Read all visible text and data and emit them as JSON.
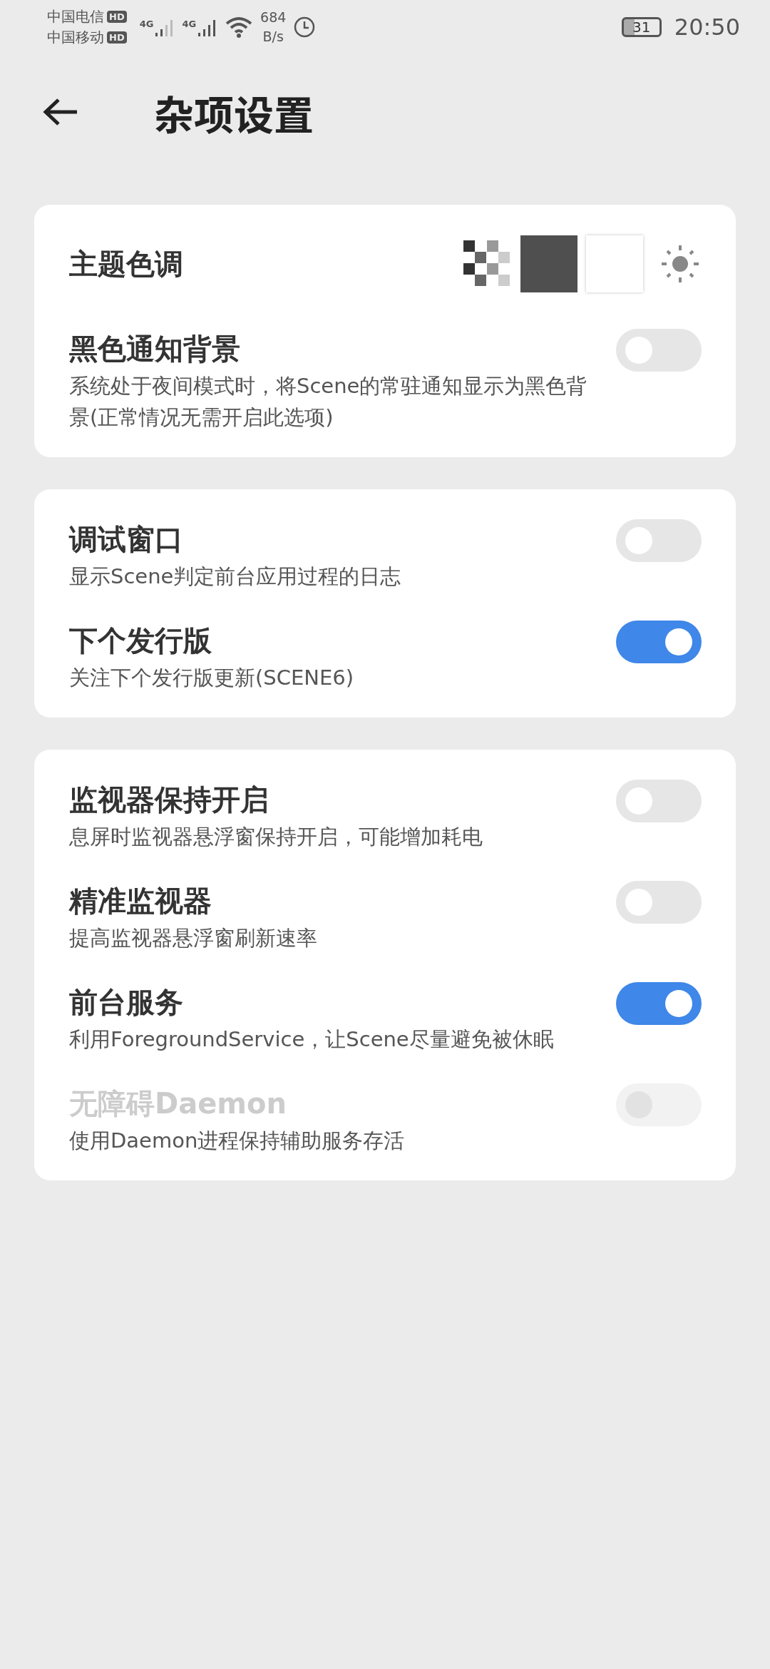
{
  "status_bar": {
    "carrier_1": "中国电信",
    "carrier_2": "中国移动",
    "hd_1": "HD",
    "hd_2": "HD",
    "net_1": "4G",
    "net_2": "4G",
    "speed_value": "684",
    "speed_unit": "B/s",
    "battery": "31",
    "time": "20:50"
  },
  "header": {
    "title": "杂项设置"
  },
  "cards": [
    {
      "items": [
        {
          "kind": "theme",
          "title": "主题色调"
        },
        {
          "kind": "switch",
          "title": "黑色通知背景",
          "subtitle": "系统处于夜间模式时，将Scene的常驻通知显示为黑色背景(正常情况无需开启此选项)",
          "on": false,
          "disabled": false
        }
      ]
    },
    {
      "items": [
        {
          "kind": "switch",
          "title": "调试窗口",
          "subtitle": "显示Scene判定前台应用过程的日志",
          "on": false,
          "disabled": false
        },
        {
          "kind": "switch",
          "title": "下个发行版",
          "subtitle": "关注下个发行版更新(SCENE6)",
          "on": true,
          "disabled": false
        }
      ]
    },
    {
      "items": [
        {
          "kind": "switch",
          "title": "监视器保持开启",
          "subtitle": "息屏时监视器悬浮窗保持开启，可能增加耗电",
          "on": false,
          "disabled": false
        },
        {
          "kind": "switch",
          "title": "精准监视器",
          "subtitle": "提高监视器悬浮窗刷新速率",
          "on": false,
          "disabled": false
        },
        {
          "kind": "switch",
          "title": "前台服务",
          "subtitle": "利用ForegroundService，让Scene尽量避免被休眠",
          "on": true,
          "disabled": false
        },
        {
          "kind": "switch",
          "title": "无障碍Daemon",
          "subtitle": "使用Daemon进程保持辅助服务存活",
          "on": false,
          "disabled": true
        }
      ]
    }
  ]
}
